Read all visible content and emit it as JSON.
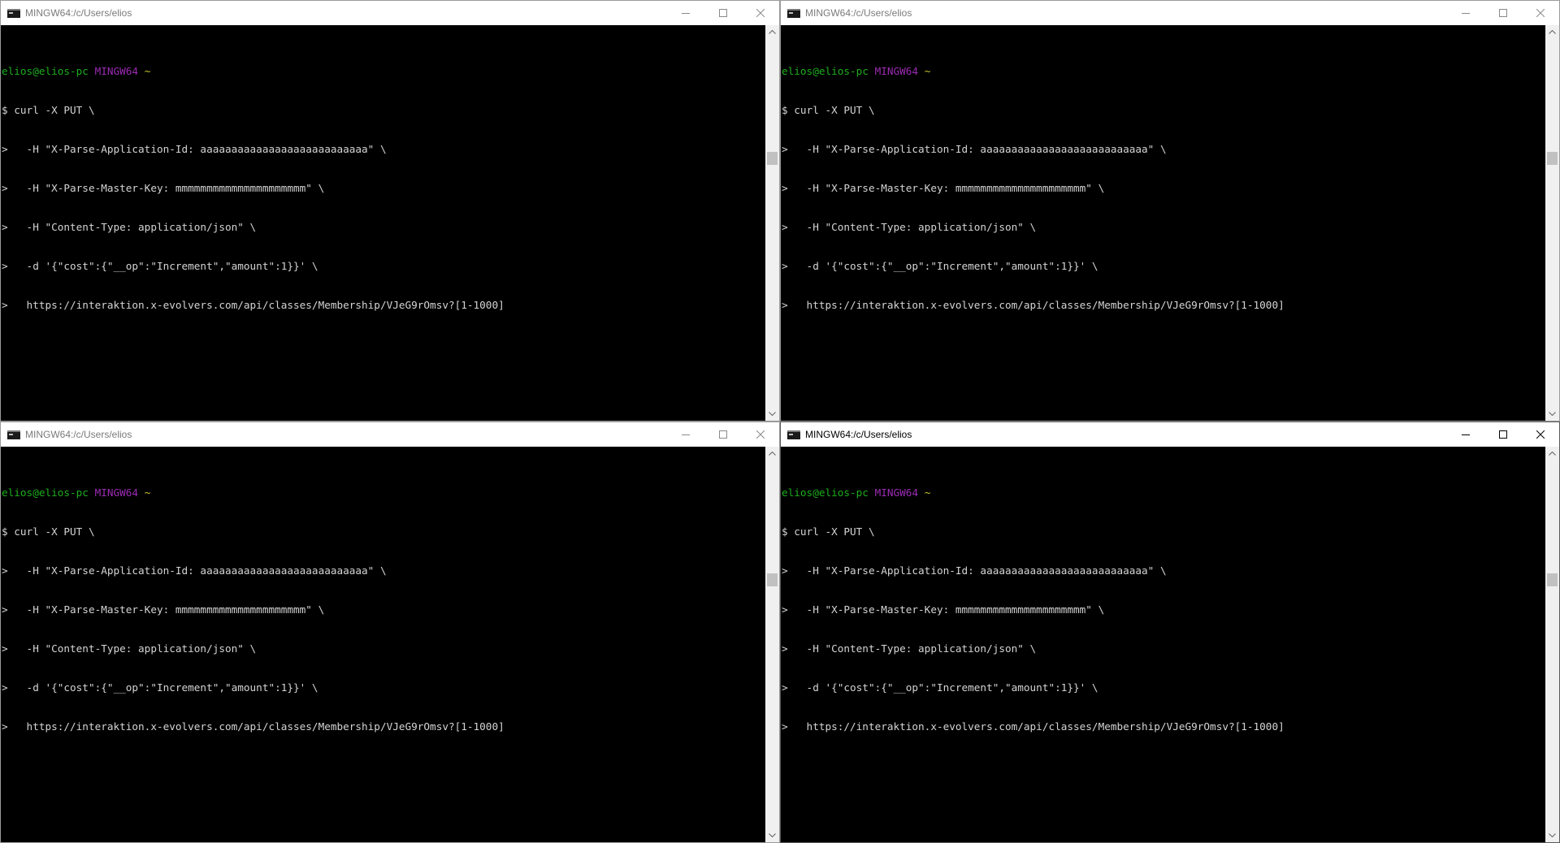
{
  "windows": [
    {
      "title": "MINGW64:/c/Users/elios",
      "active": false,
      "prompt": {
        "user_host": "elios@elios-pc",
        "shell": "MINGW64",
        "path": "~"
      },
      "lines": [
        "$ curl -X PUT \\",
        ">   -H \"X-Parse-Application-Id: aaaaaaaaaaaaaaaaaaaaaaaaaaa\" \\",
        ">   -H \"X-Parse-Master-Key: mmmmmmmmmmmmmmmmmmmmm\" \\",
        ">   -H \"Content-Type: application/json\" \\",
        ">   -d '{\"cost\":{\"__op\":\"Increment\",\"amount\":1}}' \\",
        ">   https://interaktion.x-evolvers.com/api/classes/Membership/VJeG9rOmsv?[1-1000]"
      ]
    },
    {
      "title": "MINGW64:/c/Users/elios",
      "active": false,
      "prompt": {
        "user_host": "elios@elios-pc",
        "shell": "MINGW64",
        "path": "~"
      },
      "lines": [
        "$ curl -X PUT \\",
        ">   -H \"X-Parse-Application-Id: aaaaaaaaaaaaaaaaaaaaaaaaaaa\" \\",
        ">   -H \"X-Parse-Master-Key: mmmmmmmmmmmmmmmmmmmmm\" \\",
        ">   -H \"Content-Type: application/json\" \\",
        ">   -d '{\"cost\":{\"__op\":\"Increment\",\"amount\":1}}' \\",
        ">   https://interaktion.x-evolvers.com/api/classes/Membership/VJeG9rOmsv?[1-1000]"
      ]
    },
    {
      "title": "MINGW64:/c/Users/elios",
      "active": false,
      "prompt": {
        "user_host": "elios@elios-pc",
        "shell": "MINGW64",
        "path": "~"
      },
      "lines": [
        "$ curl -X PUT \\",
        ">   -H \"X-Parse-Application-Id: aaaaaaaaaaaaaaaaaaaaaaaaaaa\" \\",
        ">   -H \"X-Parse-Master-Key: mmmmmmmmmmmmmmmmmmmmm\" \\",
        ">   -H \"Content-Type: application/json\" \\",
        ">   -d '{\"cost\":{\"__op\":\"Increment\",\"amount\":1}}' \\",
        ">   https://interaktion.x-evolvers.com/api/classes/Membership/VJeG9rOmsv?[1-1000]"
      ]
    },
    {
      "title": "MINGW64:/c/Users/elios",
      "active": true,
      "prompt": {
        "user_host": "elios@elios-pc",
        "shell": "MINGW64",
        "path": "~"
      },
      "lines": [
        "$ curl -X PUT \\",
        ">   -H \"X-Parse-Application-Id: aaaaaaaaaaaaaaaaaaaaaaaaaaa\" \\",
        ">   -H \"X-Parse-Master-Key: mmmmmmmmmmmmmmmmmmmmm\" \\",
        ">   -H \"Content-Type: application/json\" \\",
        ">   -d '{\"cost\":{\"__op\":\"Increment\",\"amount\":1}}' \\",
        ">   https://interaktion.x-evolvers.com/api/classes/Membership/VJeG9rOmsv?[1-1000]"
      ]
    }
  ],
  "icons": {
    "app": "console-icon",
    "minimize": "minimize-icon",
    "maximize": "maximize-icon",
    "close": "close-icon",
    "scroll_up": "scroll-up-arrow-icon",
    "scroll_down": "scroll-down-arrow-icon"
  },
  "colors": {
    "terminal_bg": "#000000",
    "terminal_fg": "#c0c0c0",
    "prompt_user": "#1dad1d",
    "prompt_shell": "#9b2bb3",
    "prompt_path": "#c9c92a",
    "titlebar_bg": "#ffffff"
  }
}
